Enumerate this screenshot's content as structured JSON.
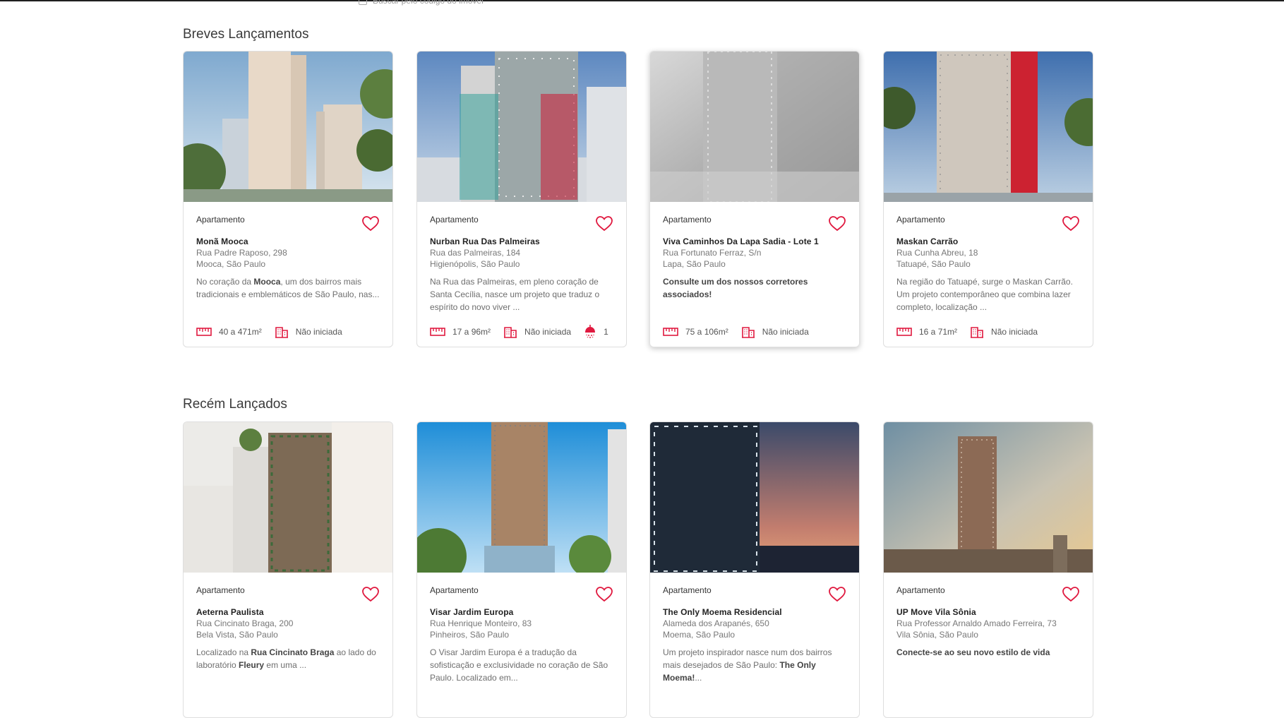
{
  "search": {
    "label": "Buscar pelo código do imóvel"
  },
  "sections": [
    {
      "title": "Breves Lançamentos",
      "cards": [
        {
          "type": "Apartamento",
          "name": "Monã Mooca",
          "address": "Rua Padre Raposo, 298",
          "location": "Mooca, São Paulo",
          "desc": [
            {
              "t": "No coração da "
            },
            {
              "t": "Mooca",
              "b": true
            },
            {
              "t": ", um dos bairros mais tradicionais e emblemáticos de São Paulo, nas..."
            }
          ],
          "area": "40 a 471m²",
          "status": "Não iniciada",
          "baths": ""
        },
        {
          "type": "Apartamento",
          "name": "Nurban Rua Das Palmeiras",
          "address": "Rua das Palmeiras, 184",
          "location": "Higienópolis, São Paulo",
          "desc": [
            {
              "t": "Na Rua das Palmeiras, em pleno coração de Santa Cecília, nasce um projeto que traduz o espírito do novo viver ..."
            }
          ],
          "area": "17 a 96m²",
          "status": "Não iniciada",
          "baths": "1"
        },
        {
          "type": "Apartamento",
          "name": "Viva Caminhos Da Lapa Sadia - Lote 1",
          "address": "Rua Fortunato Ferraz, S/n",
          "location": "Lapa, São Paulo",
          "desc": [
            {
              "t": "Consulte um dos nossos corretores associados!",
              "b": true
            }
          ],
          "area": "75 a 106m²",
          "status": "Não iniciada",
          "baths": ""
        },
        {
          "type": "Apartamento",
          "name": "Maskan Carrão",
          "address": "Rua Cunha Abreu, 18",
          "location": "Tatuapé, São Paulo",
          "desc": [
            {
              "t": "Na região do Tatuapé, surge o Maskan Carrão. Um projeto contemporâneo que combina lazer completo, localização ..."
            }
          ],
          "area": "16 a 71m²",
          "status": "Não iniciada",
          "baths": ""
        }
      ]
    },
    {
      "title": "Recém Lançados",
      "cards": [
        {
          "type": "Apartamento",
          "name": "Aeterna Paulista",
          "address": "Rua Cincinato Braga, 200",
          "location": "Bela Vista, São Paulo",
          "desc": [
            {
              "t": "Localizado na "
            },
            {
              "t": "Rua Cincinato Braga",
              "b": true
            },
            {
              "t": " ao lado do laboratório "
            },
            {
              "t": "Fleury",
              "b": true
            },
            {
              "t": " em uma ..."
            }
          ]
        },
        {
          "type": "Apartamento",
          "name": "Visar Jardim Europa",
          "address": "Rua Henrique Monteiro, 83",
          "location": "Pinheiros, São Paulo",
          "desc": [
            {
              "t": "O Visar Jardim Europa é a tradução da sofisticação e exclusividade no coração de São Paulo. Localizado em..."
            }
          ]
        },
        {
          "type": "Apartamento",
          "name": "The Only Moema Residencial",
          "address": "Alameda dos Arapanés, 650",
          "location": "Moema, São Paulo",
          "desc": [
            {
              "t": "Um projeto inspirador nasce num dos bairros mais desejados de São Paulo: "
            },
            {
              "t": "The Only Moema!",
              "b": true
            },
            {
              "t": "..."
            }
          ]
        },
        {
          "type": "Apartamento",
          "name": "UP Move Vila Sônia",
          "address": "Rua Professor Arnaldo Amado Ferreira, 73",
          "location": "Vila Sônia, São Paulo",
          "desc": [
            {
              "t": "Conecte-se ao seu novo estilo de vida",
              "b": true
            }
          ]
        }
      ]
    }
  ],
  "colors": {
    "accent": "#e0193f",
    "text_muted": "#777777",
    "card_border": "#dedede"
  },
  "icons": {
    "favorite": "heart-outline-icon",
    "area": "ruler-icon",
    "status": "building-icon",
    "baths": "shower-icon"
  }
}
